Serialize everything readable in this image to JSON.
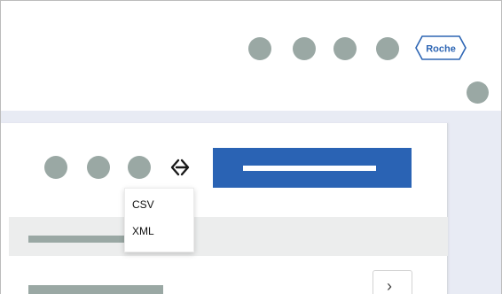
{
  "header": {
    "logo_text": "Roche",
    "icon_buttons": [
      "user-icon",
      "user-icon",
      "user-icon",
      "user-icon"
    ],
    "secondary_icon": "user-icon"
  },
  "toolbar": {
    "icon_buttons": [
      "action-icon",
      "action-icon",
      "action-icon"
    ],
    "export_icon": "export-arrows-icon"
  },
  "export_menu": {
    "items": [
      {
        "label": "CSV"
      },
      {
        "label": "XML"
      }
    ]
  },
  "pagination": {
    "next_icon": "chevron-right-icon",
    "next_glyph": "›"
  },
  "colors": {
    "brand": "#2e66b4",
    "primary_button": "#2a63b4",
    "placeholder": "#9aa8a4",
    "content_background": "#e8ebf4"
  }
}
